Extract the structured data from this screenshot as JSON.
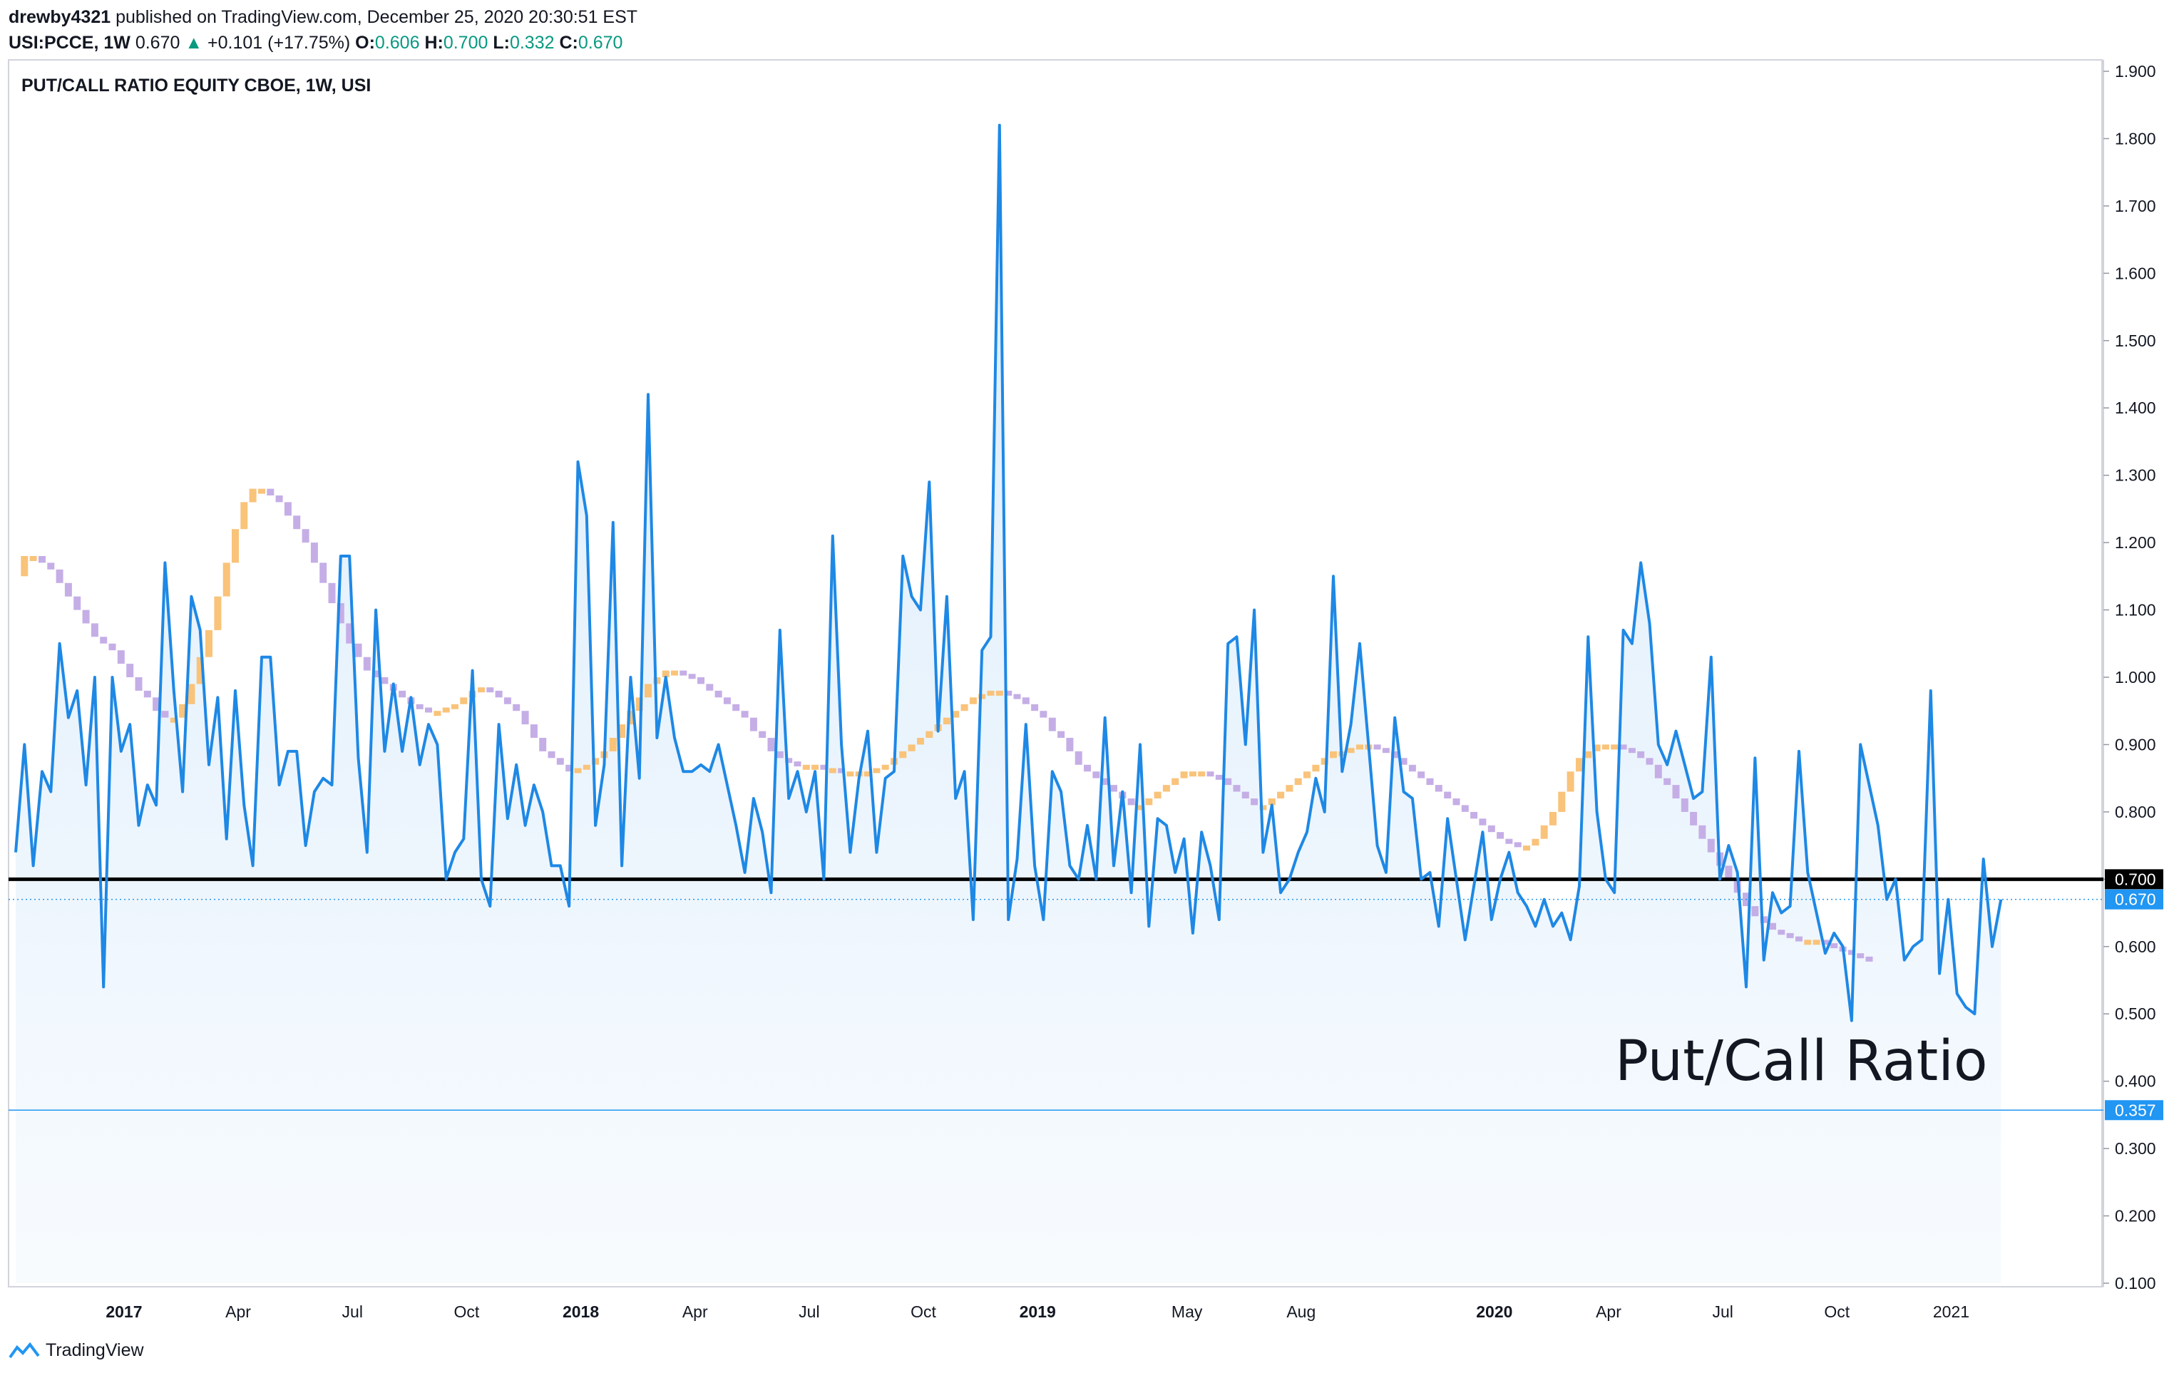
{
  "header": {
    "author": "drewby4321",
    "published": "published on TradingView.com, December 25, 2020 20:30:51 EST",
    "symbol": "USI:PCCE, 1W",
    "last": "0.670",
    "change": "+0.101 (+17.75%)",
    "o_label": "O:",
    "o_val": "0.606",
    "h_label": "H:",
    "h_val": "0.700",
    "l_label": "L:",
    "l_val": "0.332",
    "c_label": "C:",
    "c_val": "0.670"
  },
  "footer": {
    "brand": "TradingView",
    "logo_icon": "tradingview-logo-icon"
  },
  "colors": {
    "line": "#1e88e5",
    "fill": "#cfe6fa",
    "hline": "#000000",
    "level": "#2196f3",
    "ma_up": "#f9c37a",
    "ma_down": "#c5aee6",
    "label_bg": "#2196f3"
  },
  "chart_data": {
    "type": "line",
    "title": "PUT/CALL RATIO EQUITY CBOE, 1W, USI",
    "annotation": "Put/Call Ratio",
    "ylim": [
      0.1,
      1.9
    ],
    "y_ticks": [
      "1.900",
      "1.800",
      "1.700",
      "1.600",
      "1.500",
      "1.400",
      "1.300",
      "1.200",
      "1.100",
      "1.000",
      "0.900",
      "0.800",
      "0.700",
      "0.600",
      "0.500",
      "0.400",
      "0.300",
      "0.200",
      "0.100"
    ],
    "x_ticks": [
      {
        "label": "2017",
        "bold": true,
        "week": 6
      },
      {
        "label": "Apr",
        "bold": false,
        "week": 19
      },
      {
        "label": "Jul",
        "bold": false,
        "week": 32
      },
      {
        "label": "Oct",
        "bold": false,
        "week": 45
      },
      {
        "label": "2018",
        "bold": true,
        "week": 58
      },
      {
        "label": "Apr",
        "bold": false,
        "week": 71
      },
      {
        "label": "Jul",
        "bold": false,
        "week": 84
      },
      {
        "label": "Oct",
        "bold": false,
        "week": 97
      },
      {
        "label": "2019",
        "bold": true,
        "week": 110
      },
      {
        "label": "May",
        "bold": false,
        "week": 127
      },
      {
        "label": "Aug",
        "bold": false,
        "week": 140
      },
      {
        "label": "2020",
        "bold": true,
        "week": 162
      },
      {
        "label": "Apr",
        "bold": false,
        "week": 175
      },
      {
        "label": "Jul",
        "bold": false,
        "week": 188
      },
      {
        "label": "Oct",
        "bold": false,
        "week": 201
      },
      {
        "label": "2021",
        "bold": false,
        "week": 214
      }
    ],
    "horizontal_lines": [
      {
        "value": 0.7,
        "label": "0.700",
        "style": "thick-black"
      },
      {
        "value": 0.357,
        "label": "0.357",
        "style": "thin-blue"
      }
    ],
    "last_value": {
      "value": 0.67,
      "label": "0.670"
    },
    "series": [
      {
        "values": [
          0.74,
          0.9,
          0.72,
          0.86,
          0.83,
          1.05,
          0.94,
          0.98,
          0.84,
          1.0,
          0.54,
          1.0,
          0.89,
          0.93,
          0.78,
          0.84,
          0.81,
          1.17,
          0.98,
          0.83,
          1.12,
          1.07,
          0.87,
          0.97,
          0.76,
          0.98,
          0.81,
          0.72,
          1.03,
          1.03,
          0.84,
          0.89,
          0.89,
          0.75,
          0.83,
          0.85,
          0.84,
          1.18,
          1.18,
          0.88,
          0.74,
          1.1,
          0.89,
          0.99,
          0.89,
          0.97,
          0.87,
          0.93,
          0.9,
          0.7,
          0.74,
          0.76,
          1.01,
          0.7,
          0.66,
          0.93,
          0.79,
          0.87,
          0.78,
          0.84,
          0.8,
          0.72,
          0.72,
          0.66,
          1.32,
          1.24,
          0.78,
          0.87,
          1.23,
          0.72,
          1.0,
          0.85,
          1.42,
          0.91,
          1.0,
          0.91,
          0.86,
          0.86,
          0.87,
          0.86,
          0.9,
          0.84,
          0.78,
          0.71,
          0.82,
          0.77,
          0.68,
          1.07,
          0.82,
          0.86,
          0.8,
          0.86,
          0.7,
          1.21,
          0.9,
          0.74,
          0.85,
          0.92,
          0.74,
          0.85,
          0.86,
          1.18,
          1.12,
          1.1,
          1.29,
          0.92,
          1.12,
          0.82,
          0.86,
          0.64,
          1.04,
          1.06,
          1.82,
          0.64,
          0.73,
          0.93,
          0.72,
          0.64,
          0.86,
          0.83,
          0.72,
          0.7,
          0.78,
          0.7,
          0.94,
          0.72,
          0.83,
          0.68,
          0.9,
          0.63,
          0.79,
          0.78,
          0.71,
          0.76,
          0.62,
          0.77,
          0.72,
          0.64,
          1.05,
          1.06,
          0.9,
          1.1,
          0.74,
          0.81,
          0.68,
          0.7,
          0.74,
          0.77,
          0.85,
          0.8,
          1.15,
          0.86,
          0.93,
          1.05,
          0.9,
          0.75,
          0.71,
          0.94,
          0.83,
          0.82,
          0.7,
          0.71,
          0.63,
          0.79,
          0.7,
          0.61,
          0.69,
          0.77,
          0.64,
          0.7,
          0.74,
          0.68,
          0.66,
          0.63,
          0.67,
          0.63,
          0.65,
          0.61,
          0.69,
          1.06,
          0.8,
          0.7,
          0.68,
          1.07,
          1.05,
          1.17,
          1.08,
          0.9,
          0.87,
          0.92,
          0.87,
          0.82,
          0.83,
          1.03,
          0.7,
          0.75,
          0.71,
          0.54,
          0.88,
          0.58,
          0.68,
          0.65,
          0.66,
          0.89,
          0.71,
          0.65,
          0.59,
          0.62,
          0.6,
          0.49,
          0.9,
          0.84,
          0.78,
          0.67,
          0.7,
          0.58,
          0.6,
          0.61,
          0.98,
          0.56,
          0.67,
          0.53,
          0.51,
          0.5,
          0.73,
          0.6,
          0.67
        ]
      },
      {
        "name": "",
        "style": "colored-steps",
        "values": [
          1.15,
          1.18,
          1.18,
          1.17,
          1.16,
          1.14,
          1.12,
          1.1,
          1.08,
          1.06,
          1.05,
          1.04,
          1.02,
          1.0,
          0.98,
          0.97,
          0.95,
          0.94,
          0.94,
          0.96,
          0.99,
          1.03,
          1.07,
          1.12,
          1.17,
          1.22,
          1.26,
          1.28,
          1.28,
          1.27,
          1.26,
          1.24,
          1.22,
          1.2,
          1.17,
          1.14,
          1.11,
          1.08,
          1.05,
          1.03,
          1.01,
          1.0,
          0.99,
          0.98,
          0.97,
          0.96,
          0.955,
          0.95,
          0.95,
          0.955,
          0.96,
          0.97,
          0.98,
          0.985,
          0.98,
          0.97,
          0.96,
          0.95,
          0.93,
          0.91,
          0.89,
          0.88,
          0.87,
          0.86,
          0.865,
          0.87,
          0.88,
          0.89,
          0.91,
          0.93,
          0.95,
          0.97,
          0.99,
          1.0,
          1.01,
          1.01,
          1.005,
          1.0,
          0.99,
          0.98,
          0.97,
          0.96,
          0.95,
          0.94,
          0.92,
          0.91,
          0.89,
          0.88,
          0.875,
          0.87,
          0.87,
          0.87,
          0.865,
          0.865,
          0.86,
          0.86,
          0.86,
          0.86,
          0.865,
          0.87,
          0.88,
          0.89,
          0.9,
          0.91,
          0.92,
          0.93,
          0.94,
          0.95,
          0.96,
          0.97,
          0.975,
          0.98,
          0.98,
          0.975,
          0.97,
          0.96,
          0.95,
          0.94,
          0.92,
          0.91,
          0.89,
          0.87,
          0.86,
          0.85,
          0.84,
          0.83,
          0.82,
          0.81,
          0.81,
          0.82,
          0.83,
          0.84,
          0.85,
          0.86,
          0.86,
          0.86,
          0.855,
          0.85,
          0.84,
          0.83,
          0.82,
          0.81,
          0.81,
          0.82,
          0.83,
          0.84,
          0.85,
          0.86,
          0.87,
          0.88,
          0.89,
          0.89,
          0.895,
          0.9,
          0.9,
          0.895,
          0.89,
          0.88,
          0.87,
          0.86,
          0.85,
          0.84,
          0.83,
          0.82,
          0.81,
          0.8,
          0.79,
          0.78,
          0.77,
          0.76,
          0.755,
          0.75,
          0.75,
          0.76,
          0.78,
          0.8,
          0.83,
          0.86,
          0.88,
          0.89,
          0.9,
          0.9,
          0.9,
          0.895,
          0.89,
          0.88,
          0.87,
          0.85,
          0.84,
          0.82,
          0.8,
          0.78,
          0.76,
          0.74,
          0.72,
          0.7,
          0.68,
          0.66,
          0.645,
          0.635,
          0.625,
          0.62,
          0.615,
          0.61,
          0.61,
          0.61,
          0.605,
          0.6,
          0.595,
          0.59,
          0.585,
          0.58
        ]
      }
    ]
  }
}
